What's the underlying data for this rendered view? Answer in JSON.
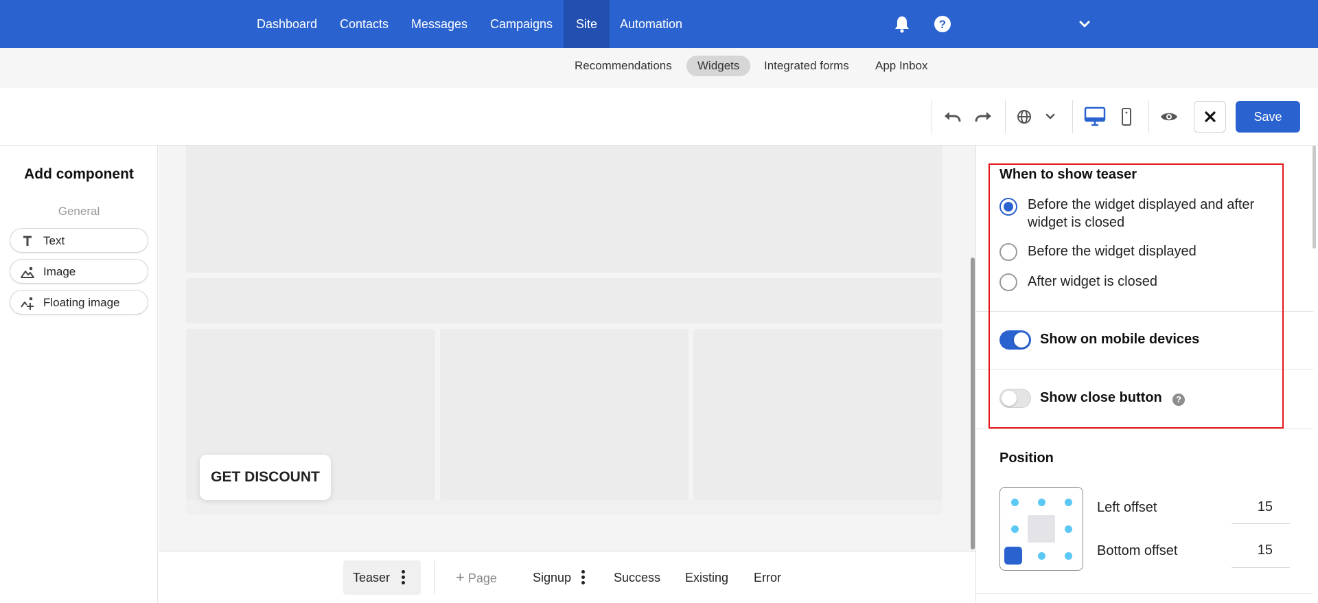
{
  "nav": {
    "items": [
      "Dashboard",
      "Contacts",
      "Messages",
      "Campaigns",
      "Site",
      "Automation"
    ],
    "active": "Site",
    "icons": [
      "bell-icon",
      "help-icon",
      "chevron-down-icon"
    ]
  },
  "subnav": {
    "items": [
      "Recommendations",
      "Widgets",
      "Integrated forms",
      "App Inbox"
    ],
    "active": "Widgets"
  },
  "toolbar": {
    "icons": [
      "undo-icon",
      "redo-icon",
      "globe-icon",
      "chevron-down-icon",
      "desktop-icon",
      "mobile-icon",
      "eye-icon",
      "close-icon"
    ],
    "save_label": "Save"
  },
  "left_panel": {
    "title": "Add component",
    "section": "General",
    "components": [
      {
        "label": "Text",
        "icon": "text-icon"
      },
      {
        "label": "Image",
        "icon": "image-icon"
      },
      {
        "label": "Floating image",
        "icon": "floating-image-icon"
      }
    ]
  },
  "canvas": {
    "teaser_text": "GET DISCOUNT"
  },
  "pagebar": {
    "teaser": "Teaser",
    "add_page": "Page",
    "signup": "Signup",
    "success": "Success",
    "existing": "Existing",
    "error": "Error"
  },
  "right_panel": {
    "when_heading": "When to show teaser",
    "options": [
      {
        "label_line1": "Before the widget displayed and after",
        "label_line2": "widget is closed",
        "selected": true
      },
      {
        "label": "Before the widget displayed",
        "selected": false
      },
      {
        "label": "After widget is closed",
        "selected": false
      }
    ],
    "show_mobile": {
      "label": "Show on mobile devices",
      "on": true
    },
    "show_close": {
      "label": "Show close button",
      "on": false,
      "help": "?"
    },
    "position": {
      "heading": "Position",
      "left_offset_label": "Left offset",
      "left_offset_value": "15",
      "bottom_offset_label": "Bottom offset",
      "bottom_offset_value": "15"
    }
  },
  "colors": {
    "brand": "#2a62cf",
    "highlight": "#e4161b",
    "position_dot": "#5bc8f5"
  }
}
